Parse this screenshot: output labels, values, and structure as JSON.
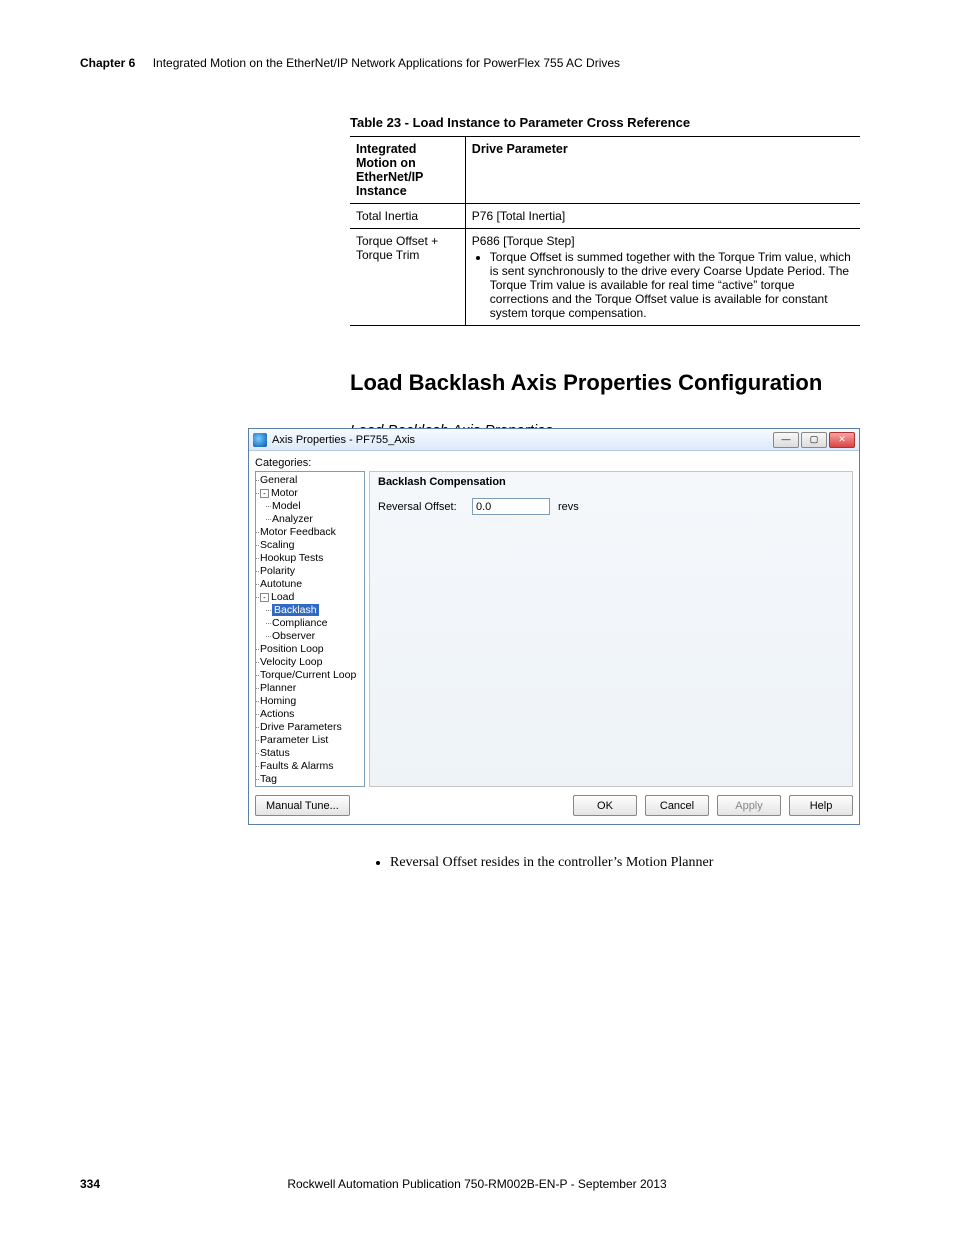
{
  "header": {
    "chapter": "Chapter 6",
    "title": "Integrated Motion on the EtherNet/IP Network Applications for PowerFlex 755 AC Drives"
  },
  "table": {
    "caption": "Table 23 - Load Instance to Parameter Cross Reference",
    "col1_header": "Integrated Motion on EtherNet/IP Instance",
    "col2_header": "Drive Parameter",
    "rows": [
      {
        "c1": "Total Inertia",
        "c2_head": "P76 [Total Inertia]",
        "c2_bullet": ""
      },
      {
        "c1": "Torque Offset + Torque Trim",
        "c2_head": "P686 [Torque Step]",
        "c2_bullet": "Torque Offset is summed together with the Torque Trim value, which is sent synchronously to the drive every Coarse Update Period. The Torque Trim value is available for real time “active” torque corrections and the Torque Offset value is available for constant system torque compensation."
      }
    ]
  },
  "section_title": "Load Backlash Axis Properties Configuration",
  "subcaption": "Load Backlash Axis Properties",
  "dialog": {
    "title": "Axis Properties - PF755_Axis",
    "categories_label": "Categories:",
    "tree": {
      "general": "General",
      "motor": "Motor",
      "model": "Model",
      "analyzer": "Analyzer",
      "motor_feedback": "Motor Feedback",
      "scaling": "Scaling",
      "hookup_tests": "Hookup Tests",
      "polarity": "Polarity",
      "autotune": "Autotune",
      "load": "Load",
      "backlash": "Backlash",
      "compliance": "Compliance",
      "observer": "Observer",
      "position_loop": "Position Loop",
      "velocity_loop": "Velocity Loop",
      "torque_current_loop": "Torque/Current Loop",
      "planner": "Planner",
      "homing": "Homing",
      "actions": "Actions",
      "drive_parameters": "Drive Parameters",
      "parameter_list": "Parameter List",
      "status": "Status",
      "faults_alarms": "Faults & Alarms",
      "tag": "Tag"
    },
    "pane_heading": "Backlash Compensation",
    "reversal_offset_label": "Reversal Offset:",
    "reversal_offset_value": "0.0",
    "reversal_offset_unit": "revs",
    "buttons": {
      "manual_tune": "Manual Tune...",
      "ok": "OK",
      "cancel": "Cancel",
      "apply": "Apply",
      "help": "Help"
    }
  },
  "bullet_after": "Reversal Offset resides in the controller’s Motion Planner",
  "footer": {
    "page": "334",
    "pub": "Rockwell Automation Publication 750-RM002B-EN-P - September 2013"
  }
}
